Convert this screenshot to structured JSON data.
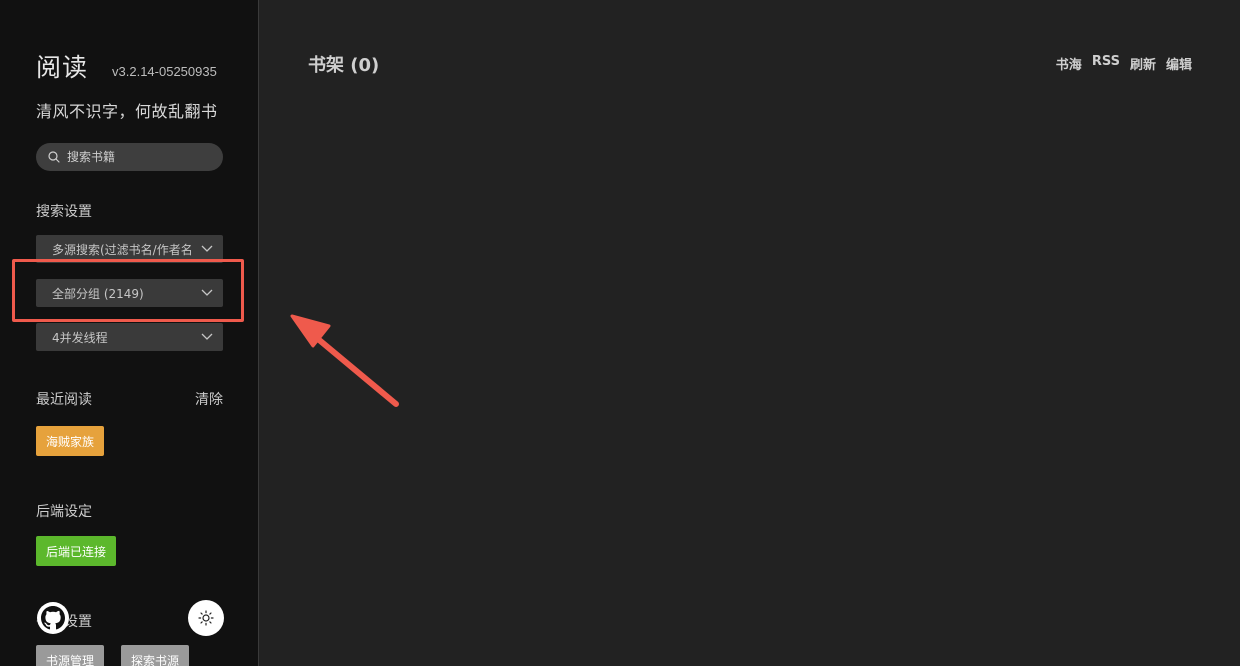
{
  "sidebar": {
    "brand_title": "阅读",
    "version": "v3.2.14-05250935",
    "tagline": "清风不识字，何故乱翻书",
    "search_placeholder": "搜索书籍",
    "search_settings_label": "搜索设置",
    "search_mode_select": "多源搜索(过滤书名/作者名",
    "group_select": "全部分组 (2149)",
    "threads_select": "4并发线程",
    "recent_label": "最近阅读",
    "clear_label": "清除",
    "recent_books": [
      "海贼家族"
    ],
    "backend_label": "后端设定",
    "backend_status": "后端已连接",
    "source_label": "书源设置",
    "source_manage_button": "书源管理",
    "explore_button": "探索书源"
  },
  "main": {
    "shelf_title": "书架 (0)",
    "actions": [
      "书海",
      "RSS",
      "刷新",
      "编辑"
    ]
  },
  "colors": {
    "sidebar_bg": "#111111",
    "main_bg": "#222222",
    "accent_orange": "#e6a23c",
    "accent_green": "#5cb82c",
    "annotation_red": "#ef5a4c"
  },
  "icons": [
    "search-icon",
    "chevron-down-icon",
    "github-icon",
    "sun-icon"
  ]
}
